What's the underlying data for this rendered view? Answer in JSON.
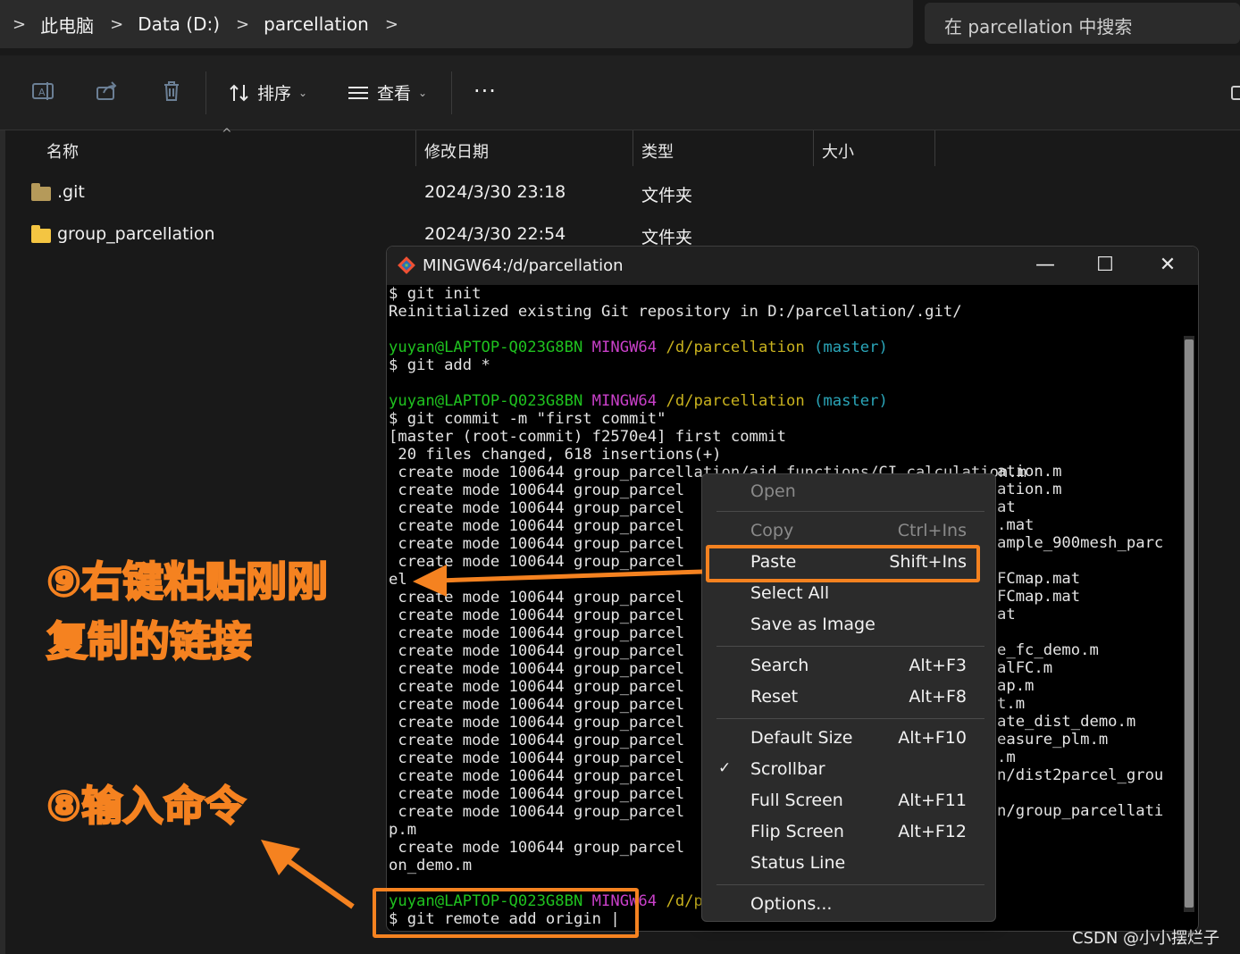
{
  "address_bar": {
    "breadcrumbs": [
      "此电脑",
      "Data (D:)",
      "parcellation"
    ],
    "separator": ">"
  },
  "search": {
    "placeholder": "在 parcellation 中搜索"
  },
  "toolbar": {
    "sort_label": "排序",
    "view_label": "查看",
    "more_label": "···"
  },
  "file_list": {
    "columns": [
      "名称",
      "修改日期",
      "类型",
      "大小"
    ],
    "rows": [
      {
        "name": ".git",
        "modified": "2024/3/30 23:18",
        "type": "文件夹"
      },
      {
        "name": "group_parcellation",
        "modified": "2024/3/30 22:54",
        "type": "文件夹"
      }
    ]
  },
  "terminal": {
    "title": "MINGW64:/d/parcellation",
    "prompt_user": "yuyan@LAPTOP-Q023G8BN",
    "prompt_shell": "MINGW64",
    "prompt_path": "/d/parcellation",
    "prompt_branch": "(master)",
    "lines": [
      "$ git init",
      "Reinitialized existing Git repository in D:/parcellation/.git/",
      "",
      "$ git add *",
      "",
      "$ git commit -m \"first commit\"",
      "[master (root-commit) f2570e4] first commit",
      " 20 files changed, 618 insertions(+)",
      " create mode 100644 group_parcellation/aid_functions/CI_calculation.m",
      " create mode 100644 group_parcel",
      " create mode 100644 group_parcel",
      " create mode 100644 group_parcel",
      " create mode 100644 group_parcel",
      " create mode 100644 group_parcel",
      "el",
      " create mode 100644 group_parcel",
      " create mode 100644 group_parcel",
      " create mode 100644 group_parcel",
      " create mode 100644 group_parcel",
      " create mode 100644 group_parcel",
      " create mode 100644 group_parcel",
      " create mode 100644 group_parcel",
      " create mode 100644 group_parcel",
      " create mode 100644 group_parcel",
      " create mode 100644 group_parcel",
      " create mode 100644 group_parcel",
      " create mode 100644 group_parcel",
      " create mode 100644 group_parcel",
      "p.m",
      " create mode 100644 group_parcel",
      "on_demo.m",
      "",
      "$ git remote add origin |"
    ],
    "right_fragments": [
      "ation.m",
      "ation.m",
      "at",
      ".mat",
      "ample_900mesh_parc",
      "",
      "FCmap.mat",
      "FCmap.mat",
      "at",
      "",
      "e_fc_demo.m",
      "alFC.m",
      "ap.m",
      "t.m",
      "ate_dist_demo.m",
      "easure_plm.m",
      ".m",
      "n/dist2parcel_grou",
      "",
      "n/group_parcellati"
    ]
  },
  "context_menu": {
    "items": [
      {
        "label": "Open",
        "shortcut": "",
        "disabled": true
      },
      {
        "label": "Copy",
        "shortcut": "Ctrl+Ins",
        "disabled": true
      },
      {
        "label": "Paste",
        "shortcut": "Shift+Ins",
        "disabled": false
      },
      {
        "label": "Select All",
        "shortcut": "",
        "disabled": false
      },
      {
        "label": "Save as Image",
        "shortcut": "",
        "disabled": false
      },
      {
        "label": "Search",
        "shortcut": "Alt+F3",
        "disabled": false
      },
      {
        "label": "Reset",
        "shortcut": "Alt+F8",
        "disabled": false
      },
      {
        "label": "Default Size",
        "shortcut": "Alt+F10",
        "disabled": false
      },
      {
        "label": "Scrollbar",
        "shortcut": "",
        "disabled": false,
        "checked": true
      },
      {
        "label": "Full Screen",
        "shortcut": "Alt+F11",
        "disabled": false
      },
      {
        "label": "Flip Screen",
        "shortcut": "Alt+F12",
        "disabled": false
      },
      {
        "label": "Status Line",
        "shortcut": "",
        "disabled": false
      },
      {
        "label": "Options...",
        "shortcut": "",
        "disabled": false
      }
    ]
  },
  "annotations": {
    "step9_line1": "⑨右键粘贴刚刚",
    "step9_line2": "复制的链接",
    "step8": "⑧输入命令",
    "color": "#f58220"
  },
  "watermark": "CSDN @小小摆烂子"
}
